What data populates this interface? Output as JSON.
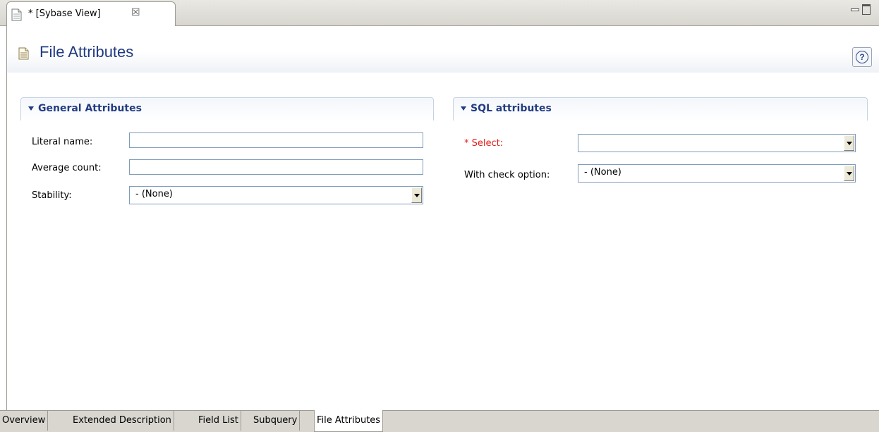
{
  "editor_tab": {
    "title": "* [Sybase View]",
    "close_icon": "close-x-icon"
  },
  "header": {
    "title": "File Attributes",
    "help_icon": "help-icon",
    "help_glyph": "?"
  },
  "sections": {
    "general": {
      "title": "General Attributes",
      "fields": {
        "literal_name": {
          "label": "Literal name:",
          "value": ""
        },
        "average_count": {
          "label": "Average count:",
          "value": ""
        },
        "stability": {
          "label": "Stability:",
          "value": "- (None)"
        }
      }
    },
    "sql": {
      "title": "SQL attributes",
      "fields": {
        "select": {
          "label": "* Select:",
          "value": "",
          "required": true
        },
        "with_check_option": {
          "label": "With check option:",
          "value": "- (None)"
        }
      }
    }
  },
  "bottom_tabs": [
    {
      "label": "Overview",
      "active": false
    },
    {
      "label": "Extended Description",
      "active": false
    },
    {
      "label": "Field List",
      "active": false
    },
    {
      "label": "Subquery",
      "active": false
    },
    {
      "label": "File Attributes",
      "active": true
    }
  ],
  "colors": {
    "title": "#1f3a80",
    "section_title": "#233c82",
    "required_label": "#e01c1c"
  }
}
